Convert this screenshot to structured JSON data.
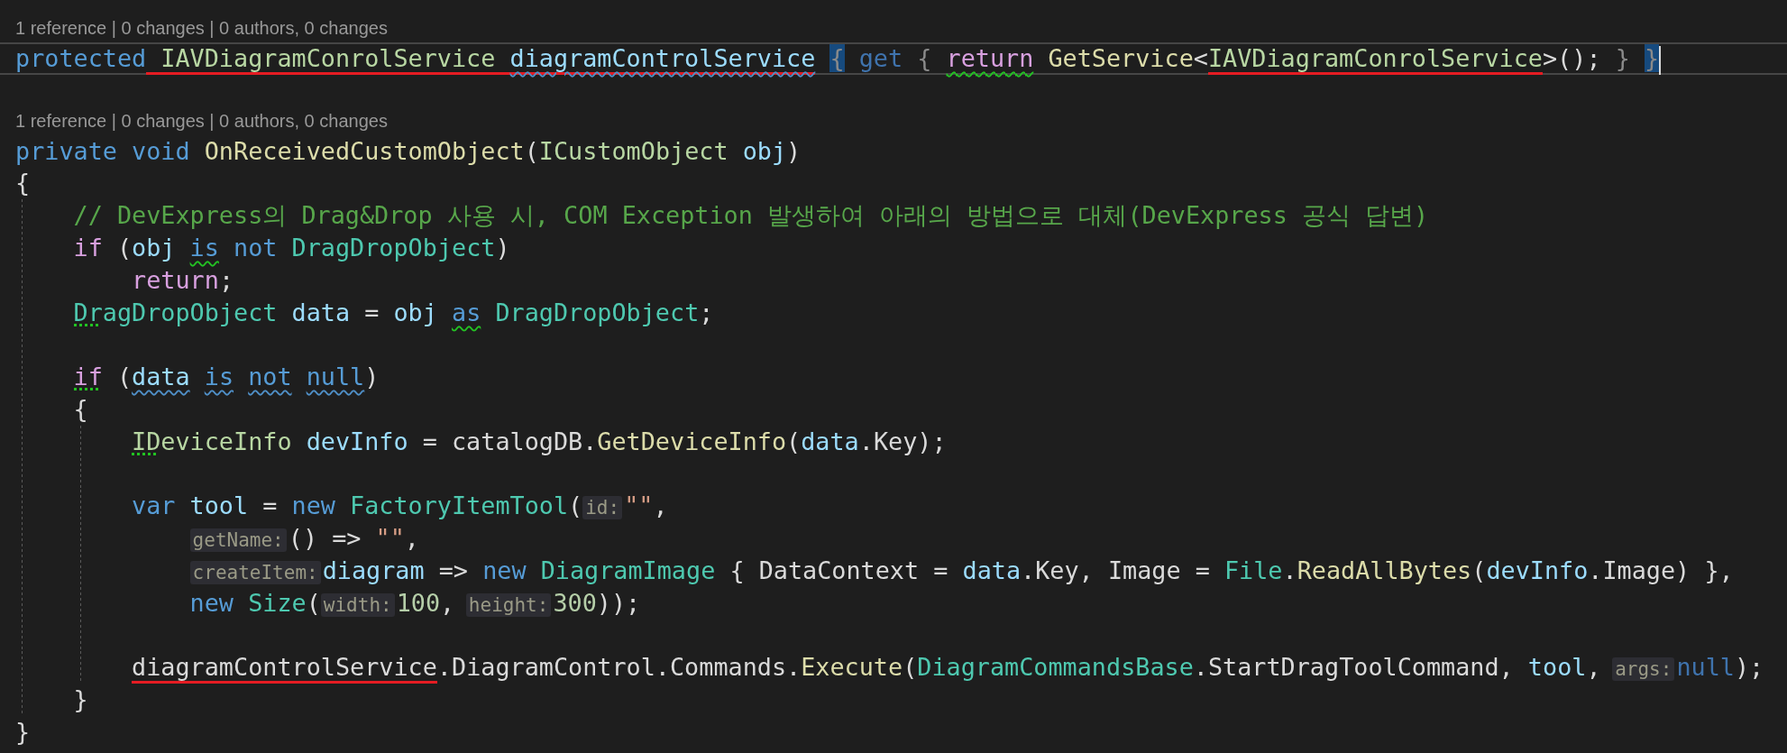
{
  "lines": [
    {
      "kind": "codelens",
      "text": "1 reference | 0 changes | 0 authors, 0 changes"
    },
    {
      "kind": "code",
      "current": true,
      "tokens": [
        {
          "text": "protected",
          "kind": "kw"
        },
        {
          "text": "IAVDiagramConrolService",
          "kind": "iface",
          "space_before": true,
          "red_underline": true
        },
        {
          "text": "diagramControlService",
          "kind": "var",
          "space_before": true,
          "red_underline": true,
          "squiggle_info": true
        },
        {
          "text": "{",
          "kind": "dim",
          "space_before": true,
          "bracket_match": true
        },
        {
          "text": "get",
          "kind": "dimkw",
          "space_before": true
        },
        {
          "text": "{",
          "kind": "dim",
          "space_before": true
        },
        {
          "text": "return",
          "kind": "ctl",
          "space_before": true,
          "squiggle_warn": true
        },
        {
          "text": "GetService",
          "kind": "fn",
          "space_before": true
        },
        {
          "text": "<",
          "kind": "plain"
        },
        {
          "text": "IAVDiagramConrolService",
          "kind": "iface",
          "red_underline": true
        },
        {
          "text": ">();",
          "kind": "plain"
        },
        {
          "text": "}",
          "kind": "dim",
          "space_before": true
        },
        {
          "text": "}",
          "kind": "dim",
          "space_before": true,
          "bracket_match": true,
          "cursor": true
        }
      ]
    },
    {
      "kind": "blank"
    },
    {
      "kind": "codelens",
      "text": "1 reference | 0 changes | 0 authors, 0 changes"
    },
    {
      "kind": "code",
      "current": false,
      "tokens": [
        {
          "text": "private",
          "kind": "kw"
        },
        {
          "text": "void",
          "kind": "kw",
          "space_before": true
        },
        {
          "text": "OnReceivedCustomObject",
          "kind": "fn",
          "space_before": true
        },
        {
          "text": "(",
          "kind": "plain"
        },
        {
          "text": "ICustomObject",
          "kind": "iface"
        },
        {
          "text": "obj",
          "kind": "var",
          "space_before": true
        },
        {
          "text": ")",
          "kind": "plain"
        }
      ]
    },
    {
      "kind": "code",
      "current": false,
      "tokens": [
        {
          "text": "{",
          "kind": "plain"
        }
      ]
    },
    {
      "kind": "code",
      "current": false,
      "tokens": [
        {
          "kind": "indent"
        },
        {
          "text": "// DevExpress의 Drag&Drop 사용 시, COM Exception 발생하여 아래의 방법으로 대체(DevExpress 공식 답변)",
          "kind": "comment"
        }
      ]
    },
    {
      "kind": "code",
      "current": false,
      "tokens": [
        {
          "kind": "indent"
        },
        {
          "text": "if",
          "kind": "ctl"
        },
        {
          "text": "(",
          "kind": "plain",
          "space_before": true
        },
        {
          "text": "obj",
          "kind": "var"
        },
        {
          "text": "is",
          "kind": "kw",
          "space_before": true,
          "squiggle_warn": true
        },
        {
          "text": "not",
          "kind": "kw",
          "space_before": true
        },
        {
          "text": "DragDropObject",
          "kind": "type",
          "space_before": true
        },
        {
          "text": ")",
          "kind": "plain"
        }
      ]
    },
    {
      "kind": "code",
      "current": false,
      "tokens": [
        {
          "kind": "indent"
        },
        {
          "kind": "space"
        },
        {
          "text": "return",
          "kind": "ctl"
        },
        {
          "text": ";",
          "kind": "plain"
        }
      ]
    },
    {
      "kind": "code",
      "current": false,
      "tokens": [
        {
          "kind": "indent"
        },
        {
          "text": "DragDropObject",
          "kind": "type",
          "dotted": true
        },
        {
          "text": "data",
          "kind": "var",
          "space_before": true
        },
        {
          "text": "=",
          "kind": "plain",
          "space_before": true
        },
        {
          "text": "obj",
          "kind": "var",
          "space_before": true
        },
        {
          "text": "as",
          "kind": "kw",
          "space_before": true,
          "squiggle_warn": true
        },
        {
          "text": "DragDropObject",
          "kind": "type",
          "space_before": true
        },
        {
          "text": ";",
          "kind": "plain"
        }
      ]
    },
    {
      "kind": "code",
      "current": false,
      "tokens": [
        {
          "kind": "indent"
        }
      ]
    },
    {
      "kind": "code",
      "current": false,
      "tokens": [
        {
          "kind": "indent"
        },
        {
          "text": "if",
          "kind": "ctl",
          "dotted": true
        },
        {
          "text": "(",
          "kind": "plain",
          "space_before": true
        },
        {
          "text": "data",
          "kind": "var",
          "squiggle_info": true
        },
        {
          "text": "is",
          "kind": "kw",
          "space_before": true,
          "squiggle_info": true
        },
        {
          "text": "not",
          "kind": "kw",
          "space_before": true,
          "squiggle_info": true
        },
        {
          "text": "null",
          "kind": "kw",
          "space_before": true,
          "squiggle_info": true
        },
        {
          "text": ")",
          "kind": "plain"
        }
      ]
    },
    {
      "kind": "code",
      "current": false,
      "tokens": [
        {
          "kind": "indent"
        },
        {
          "text": "{",
          "kind": "plain"
        }
      ]
    },
    {
      "kind": "code",
      "current": false,
      "tokens": [
        {
          "kind": "indent"
        },
        {
          "kind": "indent"
        },
        {
          "text": "IDeviceInfo",
          "kind": "iface",
          "dotted": true
        },
        {
          "text": "devInfo",
          "kind": "var",
          "space_before": true
        },
        {
          "text": "= catalogDB.",
          "kind": "plain",
          "space_before": true
        },
        {
          "text": "GetDeviceInfo",
          "kind": "fn"
        },
        {
          "text": "(",
          "kind": "plain"
        },
        {
          "text": "data",
          "kind": "var"
        },
        {
          "text": ".Key);",
          "kind": "plain"
        }
      ]
    },
    {
      "kind": "code",
      "current": false,
      "tokens": [
        {
          "kind": "indent"
        },
        {
          "kind": "indent"
        }
      ]
    },
    {
      "kind": "code",
      "current": false,
      "tokens": [
        {
          "kind": "indent"
        },
        {
          "kind": "indent"
        },
        {
          "text": "var",
          "kind": "kw"
        },
        {
          "text": "tool",
          "kind": "var",
          "space_before": true
        },
        {
          "text": "=",
          "kind": "plain",
          "space_before": true
        },
        {
          "text": "new",
          "kind": "kw",
          "space_before": true
        },
        {
          "text": "FactoryItemTool",
          "kind": "type",
          "space_before": true
        },
        {
          "text": "(",
          "kind": "plain"
        },
        {
          "text": "id:",
          "kind": "hint"
        },
        {
          "text": "\"\"",
          "kind": "str"
        },
        {
          "text": ",",
          "kind": "plain"
        }
      ]
    },
    {
      "kind": "code",
      "current": false,
      "tokens": [
        {
          "kind": "indent"
        },
        {
          "kind": "indent"
        },
        {
          "kind": "space"
        },
        {
          "text": "getName:",
          "kind": "hint"
        },
        {
          "text": "() =>",
          "kind": "plain"
        },
        {
          "text": "\"\"",
          "kind": "str",
          "space_before": true
        },
        {
          "text": ",",
          "kind": "plain"
        }
      ]
    },
    {
      "kind": "code",
      "current": false,
      "tokens": [
        {
          "kind": "indent"
        },
        {
          "kind": "indent"
        },
        {
          "kind": "space"
        },
        {
          "text": "createItem:",
          "kind": "hint"
        },
        {
          "text": "diagram",
          "kind": "var"
        },
        {
          "text": "=>",
          "kind": "plain",
          "space_before": true
        },
        {
          "text": "new",
          "kind": "kw",
          "space_before": true
        },
        {
          "text": "DiagramImage",
          "kind": "type",
          "space_before": true
        },
        {
          "text": "{ DataContext =",
          "kind": "plain",
          "space_before": true
        },
        {
          "text": "data",
          "kind": "var",
          "space_before": true
        },
        {
          "text": ".Key, Image =",
          "kind": "plain"
        },
        {
          "text": "File",
          "kind": "type",
          "space_before": true
        },
        {
          "text": ".",
          "kind": "plain"
        },
        {
          "text": "ReadAllBytes",
          "kind": "fn"
        },
        {
          "text": "(",
          "kind": "plain"
        },
        {
          "text": "devInfo",
          "kind": "var"
        },
        {
          "text": ".Image) },",
          "kind": "plain"
        }
      ]
    },
    {
      "kind": "code",
      "current": false,
      "tokens": [
        {
          "kind": "indent"
        },
        {
          "kind": "indent"
        },
        {
          "kind": "space"
        },
        {
          "text": "new",
          "kind": "kw"
        },
        {
          "text": "Size",
          "kind": "type",
          "space_before": true
        },
        {
          "text": "(",
          "kind": "plain"
        },
        {
          "text": "width:",
          "kind": "hint"
        },
        {
          "text": "100",
          "kind": "num"
        },
        {
          "text": ",",
          "kind": "plain"
        },
        {
          "text": "height:",
          "kind": "hint",
          "space_before": true
        },
        {
          "text": "300",
          "kind": "num"
        },
        {
          "text": "));",
          "kind": "plain"
        }
      ]
    },
    {
      "kind": "code",
      "current": false,
      "tokens": [
        {
          "kind": "indent"
        },
        {
          "kind": "indent"
        }
      ]
    },
    {
      "kind": "code",
      "current": false,
      "tokens": [
        {
          "kind": "indent"
        },
        {
          "kind": "indent"
        },
        {
          "text": "diagramControlService",
          "kind": "plain",
          "red_underline": true
        },
        {
          "text": ".DiagramControl.Commands.",
          "kind": "plain"
        },
        {
          "text": "Execute",
          "kind": "fn"
        },
        {
          "text": "(",
          "kind": "plain"
        },
        {
          "text": "DiagramCommandsBase",
          "kind": "type"
        },
        {
          "text": ".StartDragToolCommand,",
          "kind": "plain"
        },
        {
          "text": "tool",
          "kind": "var",
          "space_before": true
        },
        {
          "text": ",",
          "kind": "plain"
        },
        {
          "text": "args:",
          "kind": "hint",
          "space_before": true
        },
        {
          "text": "null",
          "kind": "dimkw"
        },
        {
          "text": ");",
          "kind": "plain"
        }
      ]
    },
    {
      "kind": "code",
      "current": false,
      "tokens": [
        {
          "kind": "indent"
        },
        {
          "text": "}",
          "kind": "plain"
        }
      ]
    },
    {
      "kind": "code",
      "current": false,
      "tokens": [
        {
          "text": "}",
          "kind": "plain"
        }
      ]
    }
  ]
}
